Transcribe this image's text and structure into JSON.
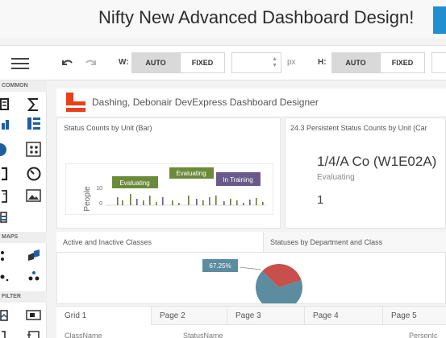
{
  "page": {
    "title": "Nifty New Advanced Dashboard Design!"
  },
  "toolbar": {
    "width_label": "W:",
    "height_label": "H:",
    "auto_label": "AUTO",
    "fixed_label": "FIXED",
    "unit": "px",
    "width_value": "",
    "icons": [
      "menu-icon",
      "undo-icon",
      "redo-icon"
    ]
  },
  "left_panel": {
    "sections": [
      "COMMON",
      "MAPS",
      "FILTER"
    ]
  },
  "dashboard": {
    "title": "Dashing, Debonair DevExpress Dashboard Designer",
    "brand_color": "#e8401c"
  },
  "bar_panel": {
    "caption": "Status Counts by Unit (Bar)",
    "chart_data": {
      "type": "bar",
      "ylabel": "People",
      "y_ticks": [
        "10",
        "0"
      ],
      "bar_color_primary": "#6b7a3a",
      "bar_color_secondary": "#6a5a8c",
      "labels": [
        {
          "text": "Evaluating",
          "color": "#6b8a3a"
        },
        {
          "text": "Evaluating",
          "color": "#6b8a3a"
        },
        {
          "text": "In Training",
          "color": "#6a5a8c"
        }
      ]
    }
  },
  "card_panel": {
    "caption": "24.3 Persistent Status Counts by Unit (Car",
    "title": "1/4/A Co (W1E02A)",
    "subtitle": "Evaluating",
    "value": "1"
  },
  "pie_panel": {
    "tab_active": "Active and Inactive Classes",
    "tab_inactive": "Statuses by Department and Class",
    "chart_data": {
      "type": "pie",
      "slices": [
        {
          "label": "67.25%",
          "value": 67.25,
          "color": "#5b8ca0"
        },
        {
          "label": "",
          "value": 32.75,
          "color": "#c8504c"
        }
      ]
    }
  },
  "grid": {
    "tabs": [
      "Grid 1",
      "Page 2",
      "Page 3",
      "Page 4",
      "Page 5"
    ],
    "columns": [
      "ClassName",
      "StatusName",
      "PersonIc"
    ]
  }
}
